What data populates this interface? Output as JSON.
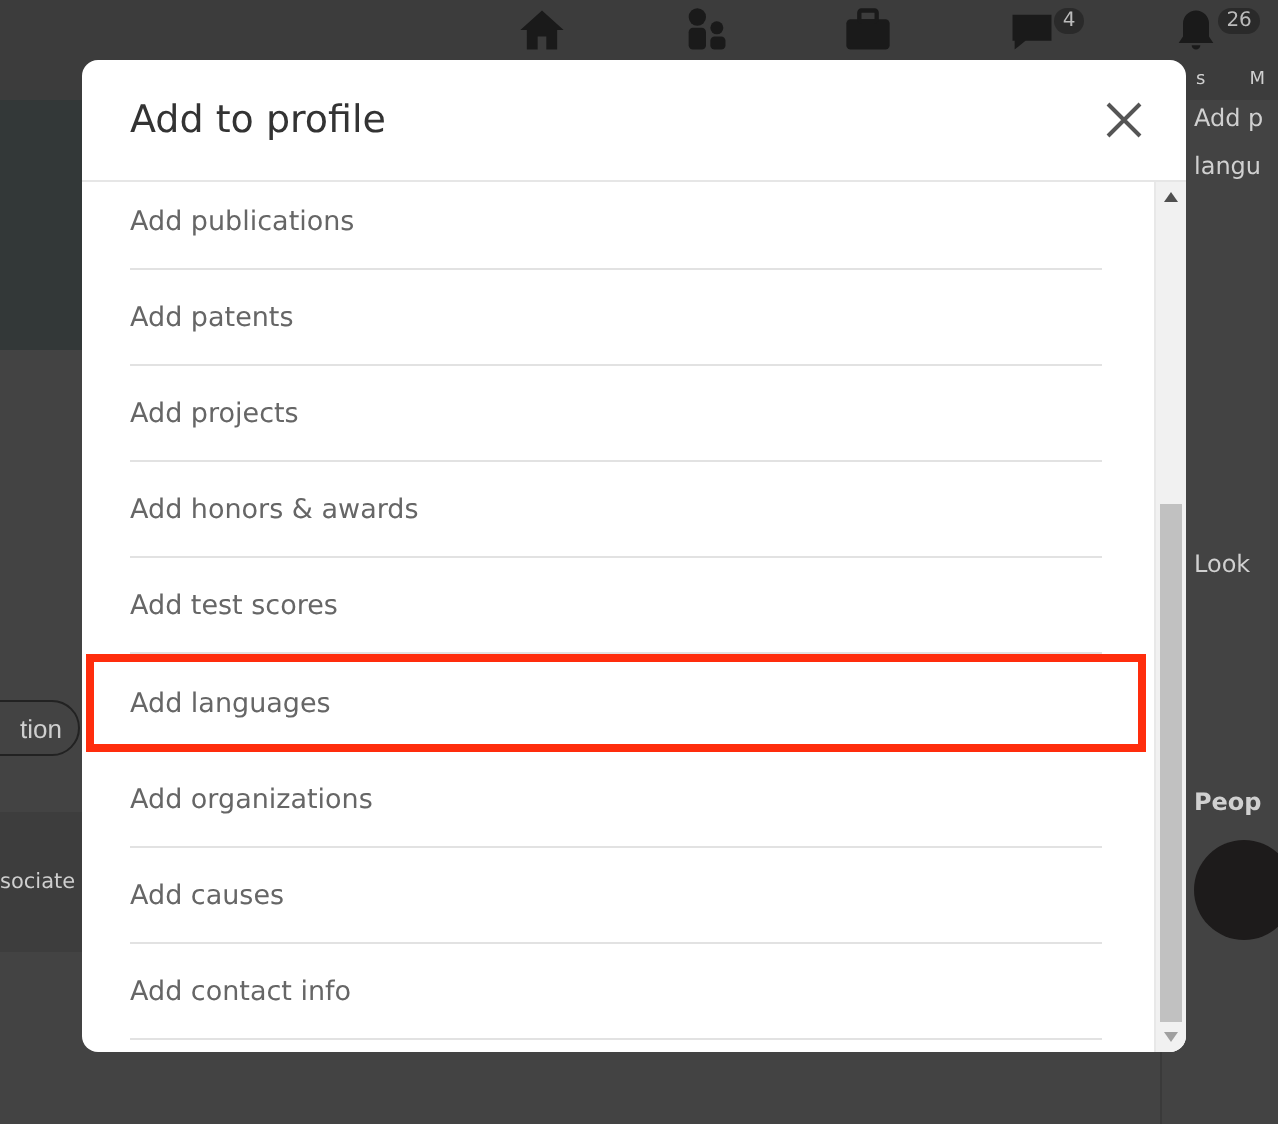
{
  "background": {
    "nav_badges": [
      "4",
      "26"
    ],
    "nav_label_fragments": [
      "s",
      "M"
    ],
    "left": {
      "button": "tion",
      "text": "sociate"
    },
    "right": {
      "heading": "Add p",
      "heading_line2": "langu",
      "text": "Look",
      "section_title": "Peop"
    }
  },
  "modal": {
    "title": "Add to profile",
    "items": [
      {
        "label": "Add publications",
        "selected": false
      },
      {
        "label": "Add patents",
        "selected": false
      },
      {
        "label": "Add projects",
        "selected": false
      },
      {
        "label": "Add honors & awards",
        "selected": false
      },
      {
        "label": "Add test scores",
        "selected": false
      },
      {
        "label": "Add languages",
        "selected": true
      },
      {
        "label": "Add organizations",
        "selected": false
      },
      {
        "label": "Add causes",
        "selected": false
      },
      {
        "label": "Add contact info",
        "selected": false
      }
    ]
  }
}
